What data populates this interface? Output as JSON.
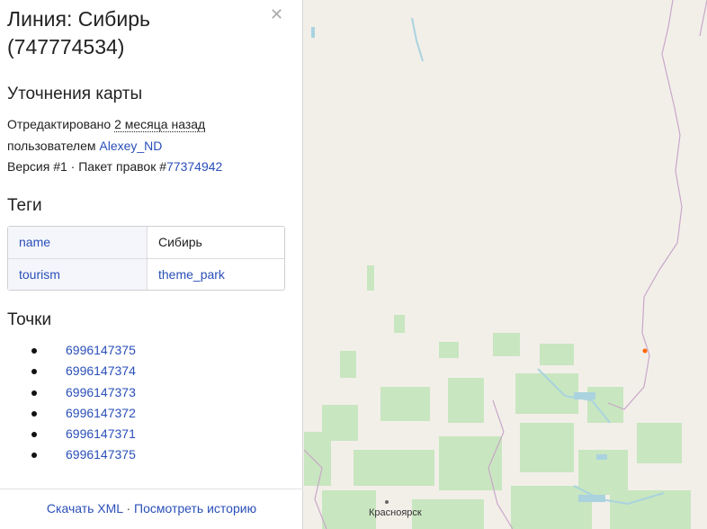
{
  "feature": {
    "title": "Линия: Сибирь (747774534)"
  },
  "changes": {
    "heading": "Уточнения карты",
    "edited_prefix": "Отредактировано ",
    "edited_when": "2 месяца назад",
    "by_prefix": "пользователем ",
    "user": "Alexey_ND",
    "version": "Версия #1",
    "separator": " · ",
    "changeset_prefix": "Пакет правок #",
    "changeset_id": "77374942"
  },
  "tags": {
    "heading": "Теги",
    "rows": [
      {
        "key": "name",
        "value": "Сибирь"
      },
      {
        "key": "tourism",
        "value": "theme_park"
      }
    ]
  },
  "nodes": {
    "heading": "Точки",
    "items": [
      "6996147375",
      "6996147374",
      "6996147373",
      "6996147372",
      "6996147371",
      "6996147375"
    ]
  },
  "footer": {
    "download": "Скачать XML",
    "separator": " · ",
    "history": "Посмотреть историю"
  },
  "map": {
    "city_label": "Красноярск",
    "colors": {
      "land": "#f2efe9",
      "forest": "#c8e6c0",
      "water": "#aad3df",
      "border": "#c9a7c9",
      "feature": "#ff6600"
    }
  }
}
